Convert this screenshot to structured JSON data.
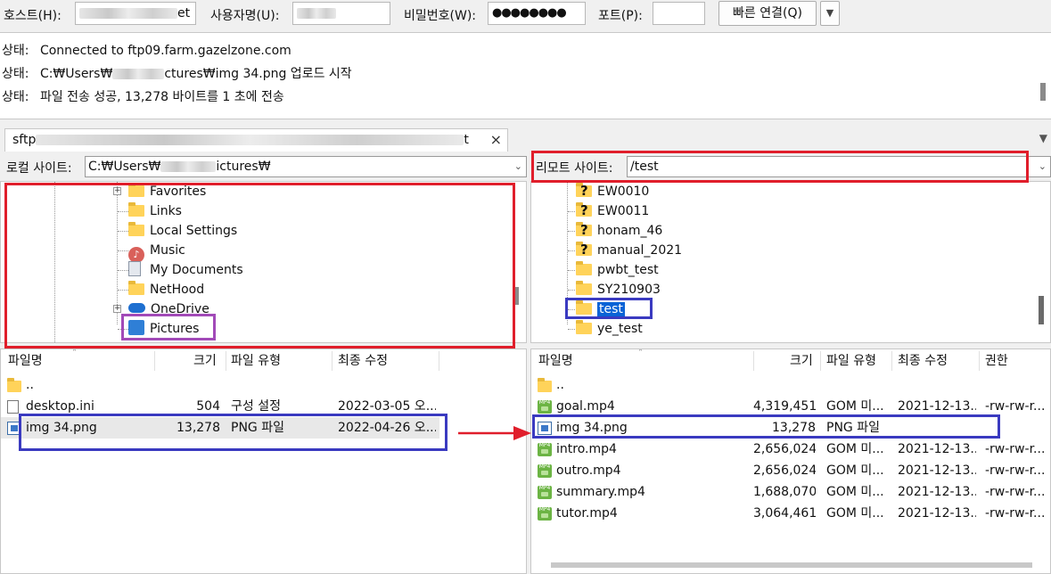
{
  "quickconnect": {
    "host_label": "호스트(H):",
    "host_value_suffix": "et",
    "user_label": "사용자명(U):",
    "password_label": "비밀번호(W):",
    "password_value": "●●●●●●●●",
    "port_label": "포트(P):",
    "port_value": "",
    "connect_button": "빠른 연결(Q)",
    "dropdown_glyph": "▼"
  },
  "log": {
    "lines": [
      {
        "prefix": "상태:",
        "text": "Connected to ftp09.farm.gazelzone.com"
      },
      {
        "prefix": "상태:",
        "text_a": "C:₩Users₩",
        "text_b": "ctures₩img 34.png 업로드 시작"
      },
      {
        "prefix": "상태:",
        "text": "파일 전송 성공, 13,278 바이트를 1 초에 전송"
      }
    ]
  },
  "tab": {
    "prefix": "sftp",
    "suffix": "t",
    "close": "×",
    "menu_glyph": "▼"
  },
  "local": {
    "site_label": "로컬 사이트:",
    "path_a": "C:₩Users₩",
    "path_b": "ictures₩",
    "tree": [
      {
        "name": "Favorites",
        "icon": "folder-icon",
        "expandable": true
      },
      {
        "name": "Links",
        "icon": "folder-icon"
      },
      {
        "name": "Local Settings",
        "icon": "folder-icon"
      },
      {
        "name": "Music",
        "icon": "music-icon"
      },
      {
        "name": "My Documents",
        "icon": "documents-icon"
      },
      {
        "name": "NetHood",
        "icon": "folder-icon"
      },
      {
        "name": "OneDrive",
        "icon": "cloud-icon",
        "expandable": true
      },
      {
        "name": "Pictures",
        "icon": "pictures-icon",
        "selected": true
      }
    ],
    "columns": [
      "파일명",
      "크기",
      "파일 유형",
      "최종 수정"
    ],
    "files": [
      {
        "name": "..",
        "size": "",
        "type": "",
        "modified": "",
        "icon": "folder-icon"
      },
      {
        "name": "desktop.ini",
        "size": "504",
        "type": "구성 설정",
        "modified": "2022-03-05 오...",
        "icon": "settings-file-icon"
      },
      {
        "name": "img 34.png",
        "size": "13,278",
        "type": "PNG 파일",
        "modified": "2022-04-26 오...",
        "icon": "image-file-icon"
      }
    ]
  },
  "remote": {
    "site_label": "리모트 사이트:",
    "path": "/test",
    "tree": [
      {
        "name": "EW0010",
        "icon": "unknown-folder-icon"
      },
      {
        "name": "EW0011",
        "icon": "unknown-folder-icon"
      },
      {
        "name": "honam_46",
        "icon": "unknown-folder-icon"
      },
      {
        "name": "manual_2021",
        "icon": "unknown-folder-icon"
      },
      {
        "name": "pwbt_test",
        "icon": "folder-icon"
      },
      {
        "name": "SY210903",
        "icon": "folder-icon"
      },
      {
        "name": "test",
        "icon": "folder-icon",
        "selected": true
      },
      {
        "name": "ye_test",
        "icon": "folder-icon"
      }
    ],
    "columns": [
      "파일명",
      "크기",
      "파일 유형",
      "최종 수정",
      "권한"
    ],
    "files": [
      {
        "name": "..",
        "size": "",
        "type": "",
        "modified": "",
        "perm": "",
        "icon": "folder-icon"
      },
      {
        "name": "goal.mp4",
        "size": "4,319,451",
        "type": "GOM 미...",
        "modified": "2021-12-13...",
        "perm": "-rw-rw-r...",
        "icon": "mp4-icon"
      },
      {
        "name": "img 34.png",
        "size": "13,278",
        "type": "PNG 파일",
        "modified": "",
        "perm": "",
        "icon": "image-file-icon"
      },
      {
        "name": "intro.mp4",
        "size": "2,656,024",
        "type": "GOM 미...",
        "modified": "2021-12-13...",
        "perm": "-rw-rw-r...",
        "icon": "mp4-icon"
      },
      {
        "name": "outro.mp4",
        "size": "2,656,024",
        "type": "GOM 미...",
        "modified": "2021-12-13...",
        "perm": "-rw-rw-r...",
        "icon": "mp4-icon"
      },
      {
        "name": "summary.mp4",
        "size": "1,688,070",
        "type": "GOM 미...",
        "modified": "2021-12-13...",
        "perm": "-rw-rw-r...",
        "icon": "mp4-icon"
      },
      {
        "name": "tutor.mp4",
        "size": "3,064,461",
        "type": "GOM 미...",
        "modified": "2021-12-13...",
        "perm": "-rw-rw-r...",
        "icon": "mp4-icon"
      }
    ]
  },
  "annotations": {
    "red": "#e01e2b",
    "blue": "#3a3ac0",
    "purple": "#a24ab8"
  },
  "mp4_badge": "MP4"
}
